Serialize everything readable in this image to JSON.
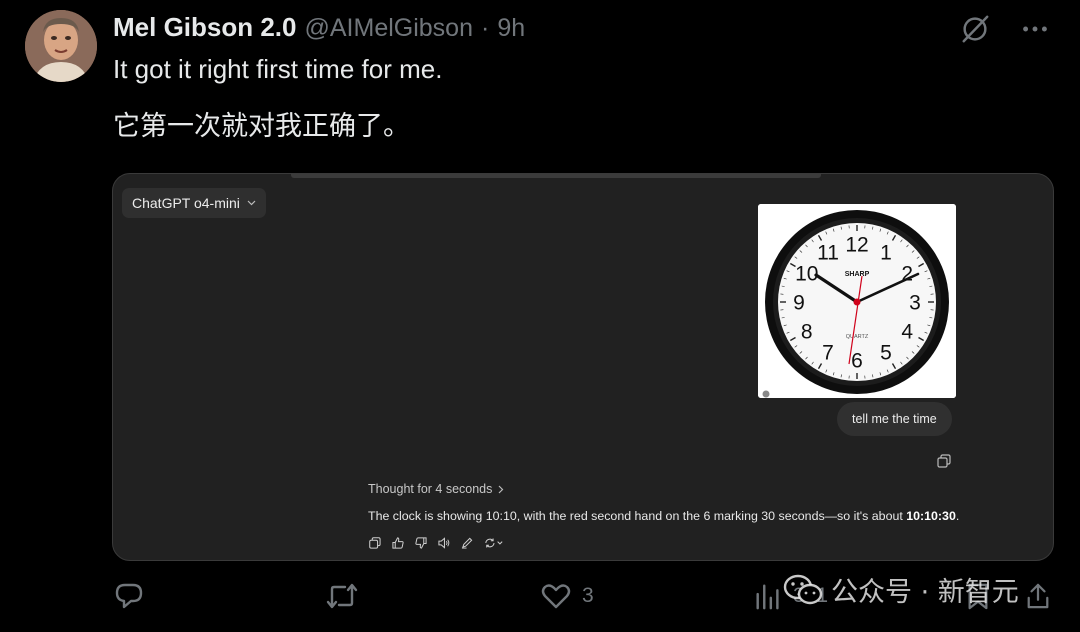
{
  "tweet": {
    "display_name": "Mel Gibson 2.0",
    "handle": "@AIMelGibson",
    "separator": "·",
    "time": "9h",
    "text_en": "It got it right first time for me.",
    "text_zh": "它第一次就对我正确了。"
  },
  "chat": {
    "model_label": "ChatGPT o4-mini",
    "user_message": "tell me the time",
    "thought_label": "Thought for 4 seconds",
    "answer_prefix": "The clock is showing 10:10, with the red second hand on the 6 marking 30 seconds—so it's about ",
    "answer_bold": "10:10:30",
    "answer_suffix": ".",
    "clock": {
      "brand": "SHARP",
      "sublabel": "QUARTZ",
      "numerals": [
        "12",
        "1",
        "2",
        "3",
        "4",
        "5",
        "6",
        "7",
        "8",
        "9",
        "10",
        "11"
      ]
    }
  },
  "footer": {
    "reply_count": "",
    "retweet_count": "",
    "like_count": "3",
    "view_count": "381"
  },
  "watermark": {
    "text": "公众号 · 新智元"
  },
  "colors": {
    "background": "#000000",
    "panel": "#212121",
    "muted": "#71767b",
    "text": "#e7e9ea",
    "second_hand": "#d0021b"
  }
}
